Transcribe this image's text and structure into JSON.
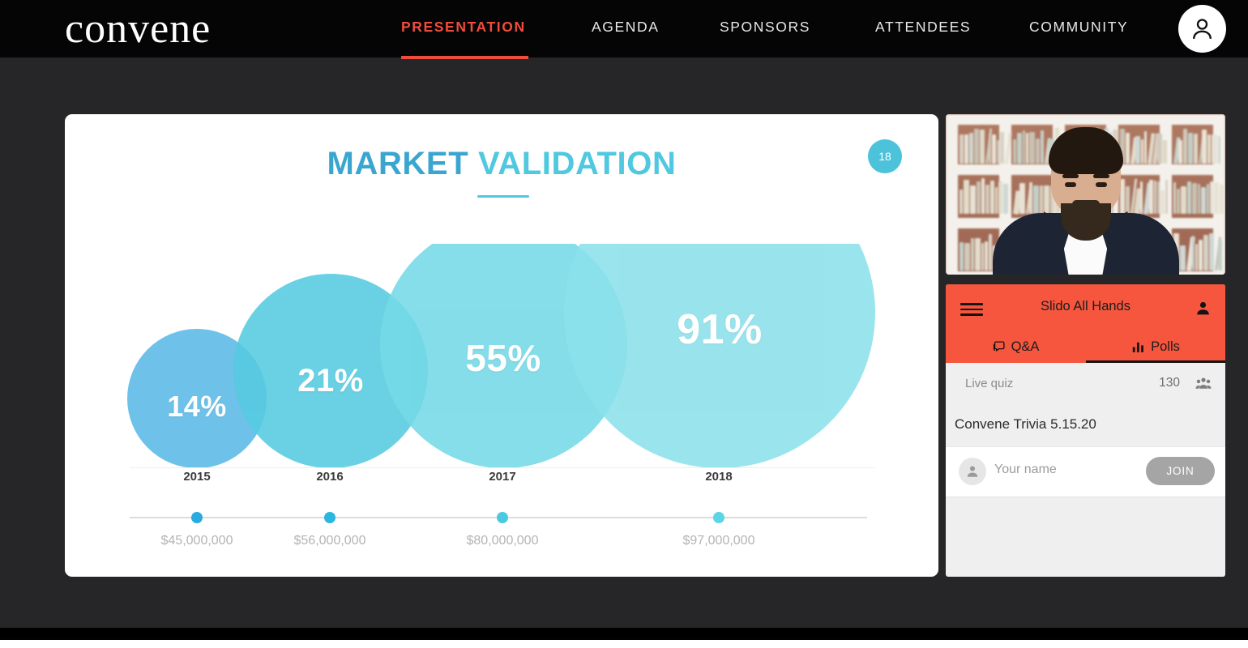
{
  "nav": {
    "logo": "convene",
    "items": [
      {
        "label": "PRESENTATION",
        "active": true
      },
      {
        "label": "AGENDA",
        "active": false
      },
      {
        "label": "SPONSORS",
        "active": false
      },
      {
        "label": "ATTENDEES",
        "active": false
      },
      {
        "label": "COMMUNITY",
        "active": false
      }
    ],
    "accent_color": "#ef4d3c",
    "avatar_icon": "person-icon"
  },
  "slide": {
    "title_part1": "MARKET",
    "title_part2": "VALIDATION",
    "slide_number_badge": "18",
    "badge_color": "#4cc3da"
  },
  "chart_data": {
    "type": "bar",
    "title": "MARKET VALIDATION",
    "categories": [
      "2015",
      "2016",
      "2017",
      "2018"
    ],
    "values": [
      14,
      21,
      55,
      91
    ],
    "value_labels": [
      "14%",
      "21%",
      "55%",
      "91%"
    ],
    "secondary_labels": [
      "$45,000,000",
      "$56,000,000",
      "$80,000,000",
      "$97,000,000"
    ],
    "secondary_values": [
      45000000,
      56000000,
      80000000,
      97000000
    ],
    "xlabel": "",
    "ylabel": "",
    "ylim": [
      0,
      100
    ],
    "grid": false,
    "legend": "none",
    "bubble_colors": [
      "#5bb9e6",
      "#55cbe0",
      "#74d9e6",
      "#8ce1ea"
    ],
    "marker_colors": [
      "#29abdf",
      "#2cb5df",
      "#4ac9e0",
      "#5cd5e5"
    ]
  },
  "video": {
    "label": "speaker-video-feed"
  },
  "slido": {
    "menu_icon": "hamburger-icon",
    "title": "Slido All Hands",
    "profile_icon": "person-icon",
    "tabs": [
      {
        "label": "Q&A",
        "icon": "speech-bubble-icon",
        "active": false
      },
      {
        "label": "Polls",
        "icon": "bar-chart-icon",
        "active": true
      }
    ],
    "header_color": "#f5563d",
    "quiz_kind": "Live quiz",
    "participant_count": "130",
    "participant_icon": "group-icon",
    "quiz_title": "Convene Trivia 5.15.20",
    "name_placeholder": "Your name",
    "name_value": "",
    "join_label": "JOIN",
    "join_avatar_icon": "person-icon"
  }
}
